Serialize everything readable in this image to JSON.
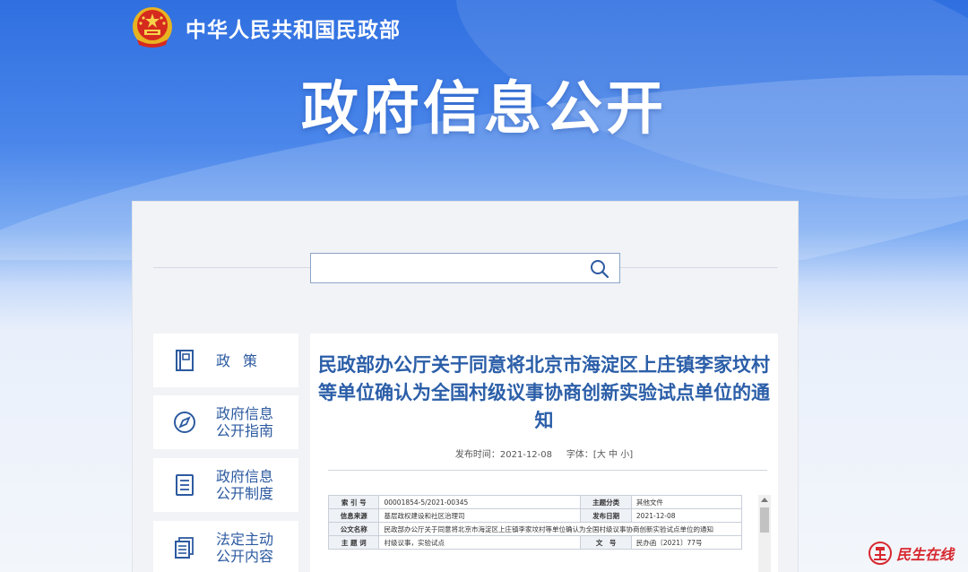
{
  "header": {
    "ministry_name": "中华人民共和国民政部",
    "hero_title": "政府信息公开"
  },
  "search": {
    "placeholder": ""
  },
  "sidebar": {
    "items": [
      {
        "label": "政策",
        "icon": "book-icon"
      },
      {
        "label": "政府信息\n公开指南",
        "icon": "compass-icon"
      },
      {
        "label": "政府信息\n公开制度",
        "icon": "document-list-icon"
      },
      {
        "label": "法定主动\n公开内容",
        "icon": "documents-stack-icon"
      }
    ]
  },
  "document": {
    "title": "民政部办公厅关于同意将北京市海淀区上庄镇李家坟村等单位确认为全国村级议事协商创新实验试点单位的通知",
    "publish_label": "发布时间：",
    "publish_date": "2021-12-08",
    "font_label": "字体：",
    "font_sizes": [
      "[大",
      "中",
      "小]"
    ],
    "info_table": {
      "index_label": "索 引 号",
      "index_value": "00001854-5/2021-00345",
      "topic_label": "主题分类",
      "topic_value": "其他文件",
      "source_label": "信息来源",
      "source_value": "基层政权建设和社区治理司",
      "issue_date_label": "发布日期",
      "issue_date_value": "2021-12-08",
      "doc_name_label": "公文名称",
      "doc_name_value": "民政部办公厅关于同意将北京市海淀区上庄镇李家坟村等单位确认为全国村级议事协商创新实验试点单位的通知",
      "keywords_label": "主 题 词",
      "keywords_value": "村级议事，实验试点",
      "doc_no_label": "文　号",
      "doc_no_value": "民办函〔2021〕77号"
    }
  },
  "watermark": {
    "text": "民生在线"
  },
  "colors": {
    "nav_text": "#2c5aa0",
    "title_text": "#2b5ea8",
    "watermark_red": "#d7282f"
  }
}
